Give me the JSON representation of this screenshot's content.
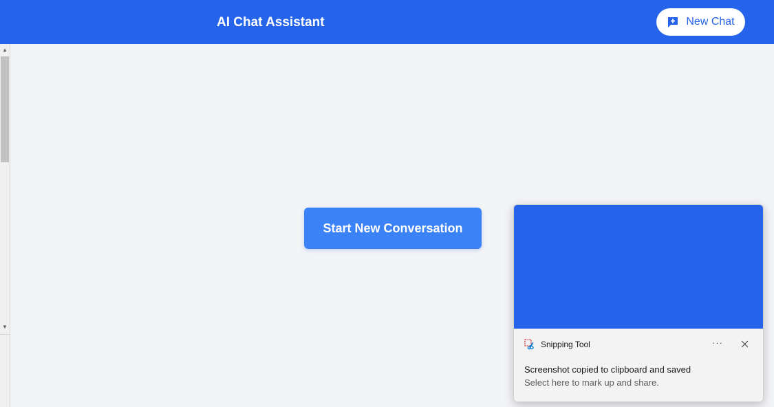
{
  "header": {
    "title": "AI Chat Assistant",
    "new_chat_label": "New Chat",
    "new_chat_icon": "chat-plus-icon",
    "background": "#2563eb"
  },
  "main": {
    "start_label": "Start New Conversation",
    "button_color": "#3b82f6",
    "background": "#f3f4f6"
  },
  "scrollbar": {
    "up_icon": "scroll-up-arrow-icon",
    "down_icon": "scroll-down-arrow-icon"
  },
  "toast": {
    "app_name": "Snipping Tool",
    "app_icon": "snipping-tool-icon",
    "title": "Screenshot copied to clipboard and saved",
    "subtitle": "Select here to mark up and share.",
    "more_glyph": "···",
    "close_icon": "close-icon",
    "preview_color": "#2563eb"
  }
}
